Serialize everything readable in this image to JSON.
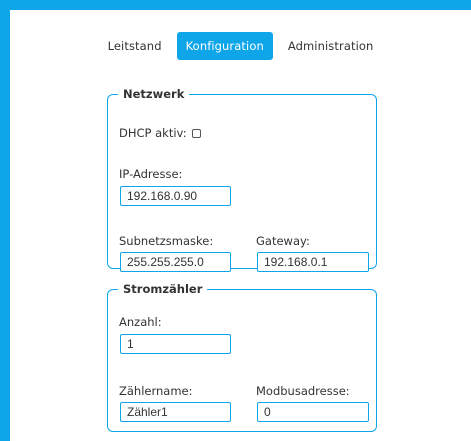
{
  "nav": {
    "items": [
      "Leitstand",
      "Konfiguration",
      "Administration"
    ],
    "active": "Konfiguration"
  },
  "network": {
    "legend": "Netzwerk",
    "dhcp_label": "DHCP aktiv:",
    "dhcp_checked": false,
    "ip_label": "IP-Adresse:",
    "ip_value": "192.168.0.90",
    "subnet_label": "Subnetzsmaske:",
    "subnet_value": "255.255.255.0",
    "gateway_label": "Gateway:",
    "gateway_value": "192.168.0.1"
  },
  "meter": {
    "legend": "Stromzähler",
    "count_label": "Anzahl:",
    "count_value": "1",
    "name_label": "Zählername:",
    "name_value": "Zähler1",
    "modbus_label": "Modbusadresse:",
    "modbus_value": "0"
  },
  "colors": {
    "accent": "#0ea5e9",
    "text": "#333333"
  }
}
